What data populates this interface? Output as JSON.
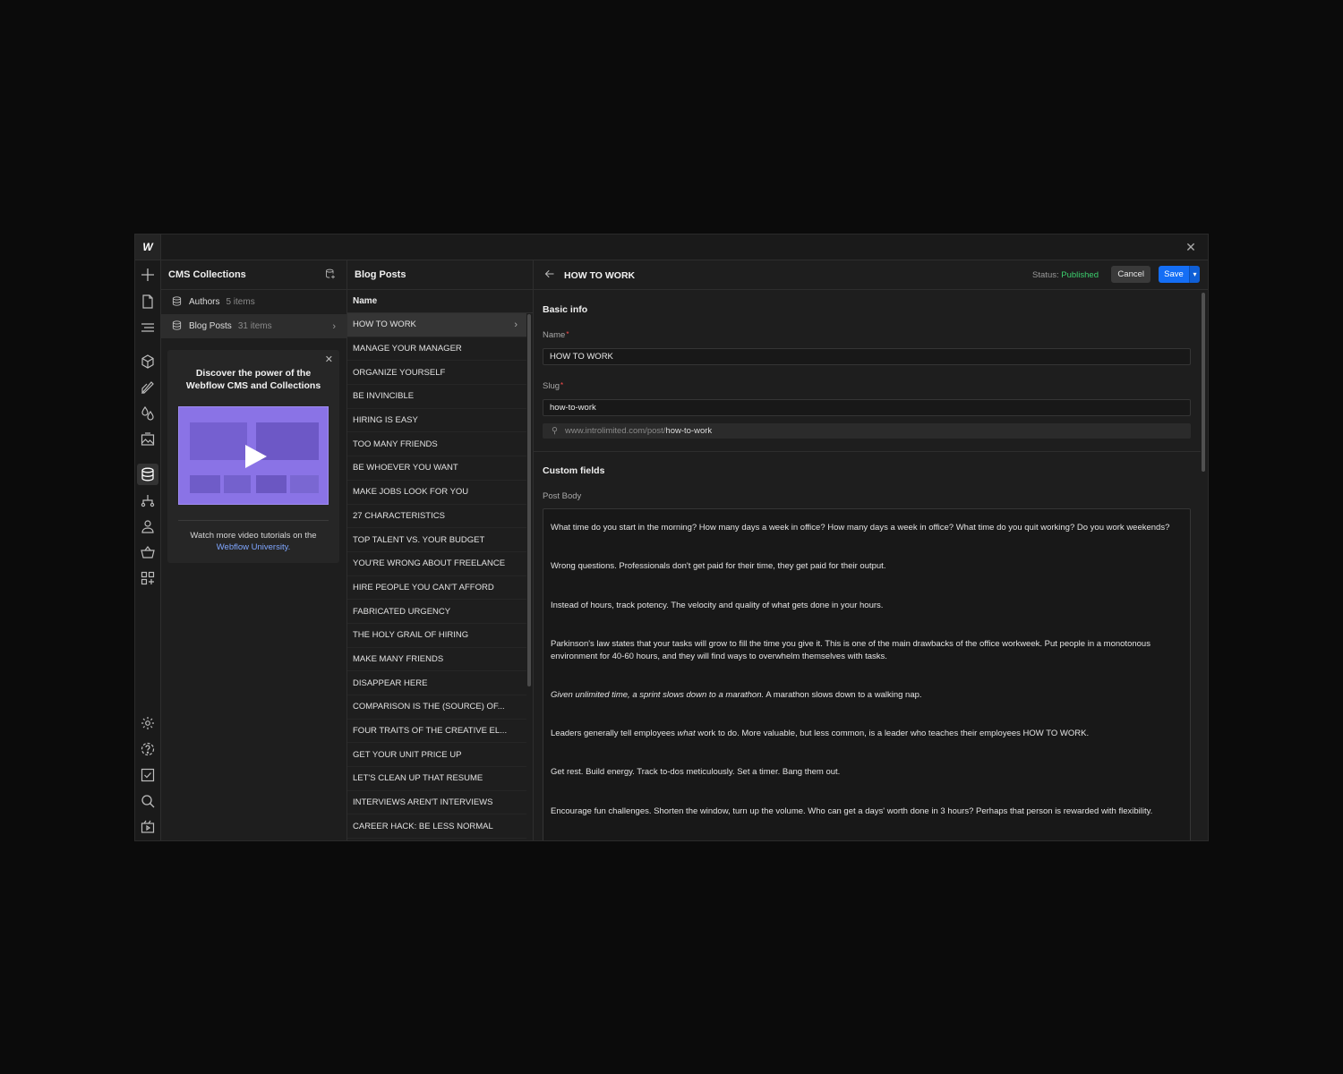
{
  "window": {
    "logo": "W"
  },
  "collections": {
    "title": "CMS Collections",
    "items": [
      {
        "name": "Authors",
        "count": "5 items"
      },
      {
        "name": "Blog Posts",
        "count": "31 items"
      }
    ]
  },
  "promo": {
    "title_line1": "Discover the power of the",
    "title_line2": "Webflow CMS and Collections",
    "footer_text": "Watch more video tutorials on the",
    "footer_link": "Webflow University."
  },
  "posts": {
    "title": "Blog Posts",
    "column_header": "Name",
    "items": [
      "HOW TO WORK",
      "MANAGE YOUR MANAGER",
      "ORGANIZE YOURSELF",
      "BE INVINCIBLE",
      "HIRING IS EASY",
      "TOO MANY FRIENDS",
      "BE WHOEVER YOU WANT",
      "MAKE JOBS LOOK FOR YOU",
      "27 CHARACTERISTICS",
      "TOP TALENT VS. YOUR BUDGET",
      "YOU'RE WRONG ABOUT FREELANCE",
      "HIRE PEOPLE YOU CAN'T AFFORD",
      "FABRICATED URGENCY",
      "THE HOLY GRAIL OF HIRING",
      "MAKE MANY FRIENDS",
      "DISAPPEAR HERE",
      "COMPARISON IS THE (SOURCE) OF...",
      "FOUR TRAITS OF THE CREATIVE EL...",
      "GET YOUR UNIT PRICE UP",
      "LET'S CLEAN UP THAT RESUME",
      "INTERVIEWS AREN'T INTERVIEWS",
      "CAREER HACK: BE LESS NORMAL"
    ]
  },
  "detail": {
    "title": "HOW TO WORK",
    "status_label": "Status:",
    "status_value": "Published",
    "cancel_label": "Cancel",
    "save_label": "Save",
    "basic_info_title": "Basic info",
    "name_label": "Name",
    "name_value": "HOW TO WORK",
    "slug_label": "Slug",
    "slug_value": "how-to-work",
    "url_base": "www.introlimited.com/post/",
    "url_slug": "how-to-work",
    "custom_fields_title": "Custom fields",
    "post_body_label": "Post Body",
    "body": {
      "p1": "What time do you start in the morning? How many days a week in office? How many days a week in office? What time do you quit working? Do you work weekends?",
      "p2": "Wrong questions. Professionals don't get paid for their time, they get paid for their output.",
      "p3": "Instead of hours, track potency. The velocity and quality of what gets done in your hours.",
      "p4": "Parkinson's law states that your tasks will grow to fill the time you give it. This is one of the main drawbacks of the office workweek. Put people in a monotonous environment for 40-60 hours, and they will find ways to overwhelm themselves with tasks.",
      "p5_italic": "Given unlimited time, a sprint slows down to a marathon.",
      "p5_rest": " A marathon slows down to a walking nap.",
      "p6_a": "Leaders generally tell employees ",
      "p6_italic": "what",
      "p6_b": " work to do. More valuable, but less common, is a leader who teaches their employees HOW TO WORK.",
      "p7": "Get rest. Build energy. Track to-dos meticulously. Set a timer. Bang them out.",
      "p8": "Encourage fun challenges. Shorten the window, turn up the volume. Who can get a days' worth done in 3 hours? Perhaps that person is rewarded with flexibility."
    }
  },
  "icons": {
    "sidebar": [
      "plus-icon",
      "page-icon",
      "navigator-icon",
      "components-icon",
      "style-icon",
      "variables-icon",
      "assets-icon",
      "cms-icon",
      "logic-icon",
      "users-icon",
      "ecommerce-icon",
      "apps-icon",
      "settings-icon",
      "help-icon",
      "audit-icon",
      "search-icon",
      "video-icon"
    ]
  }
}
